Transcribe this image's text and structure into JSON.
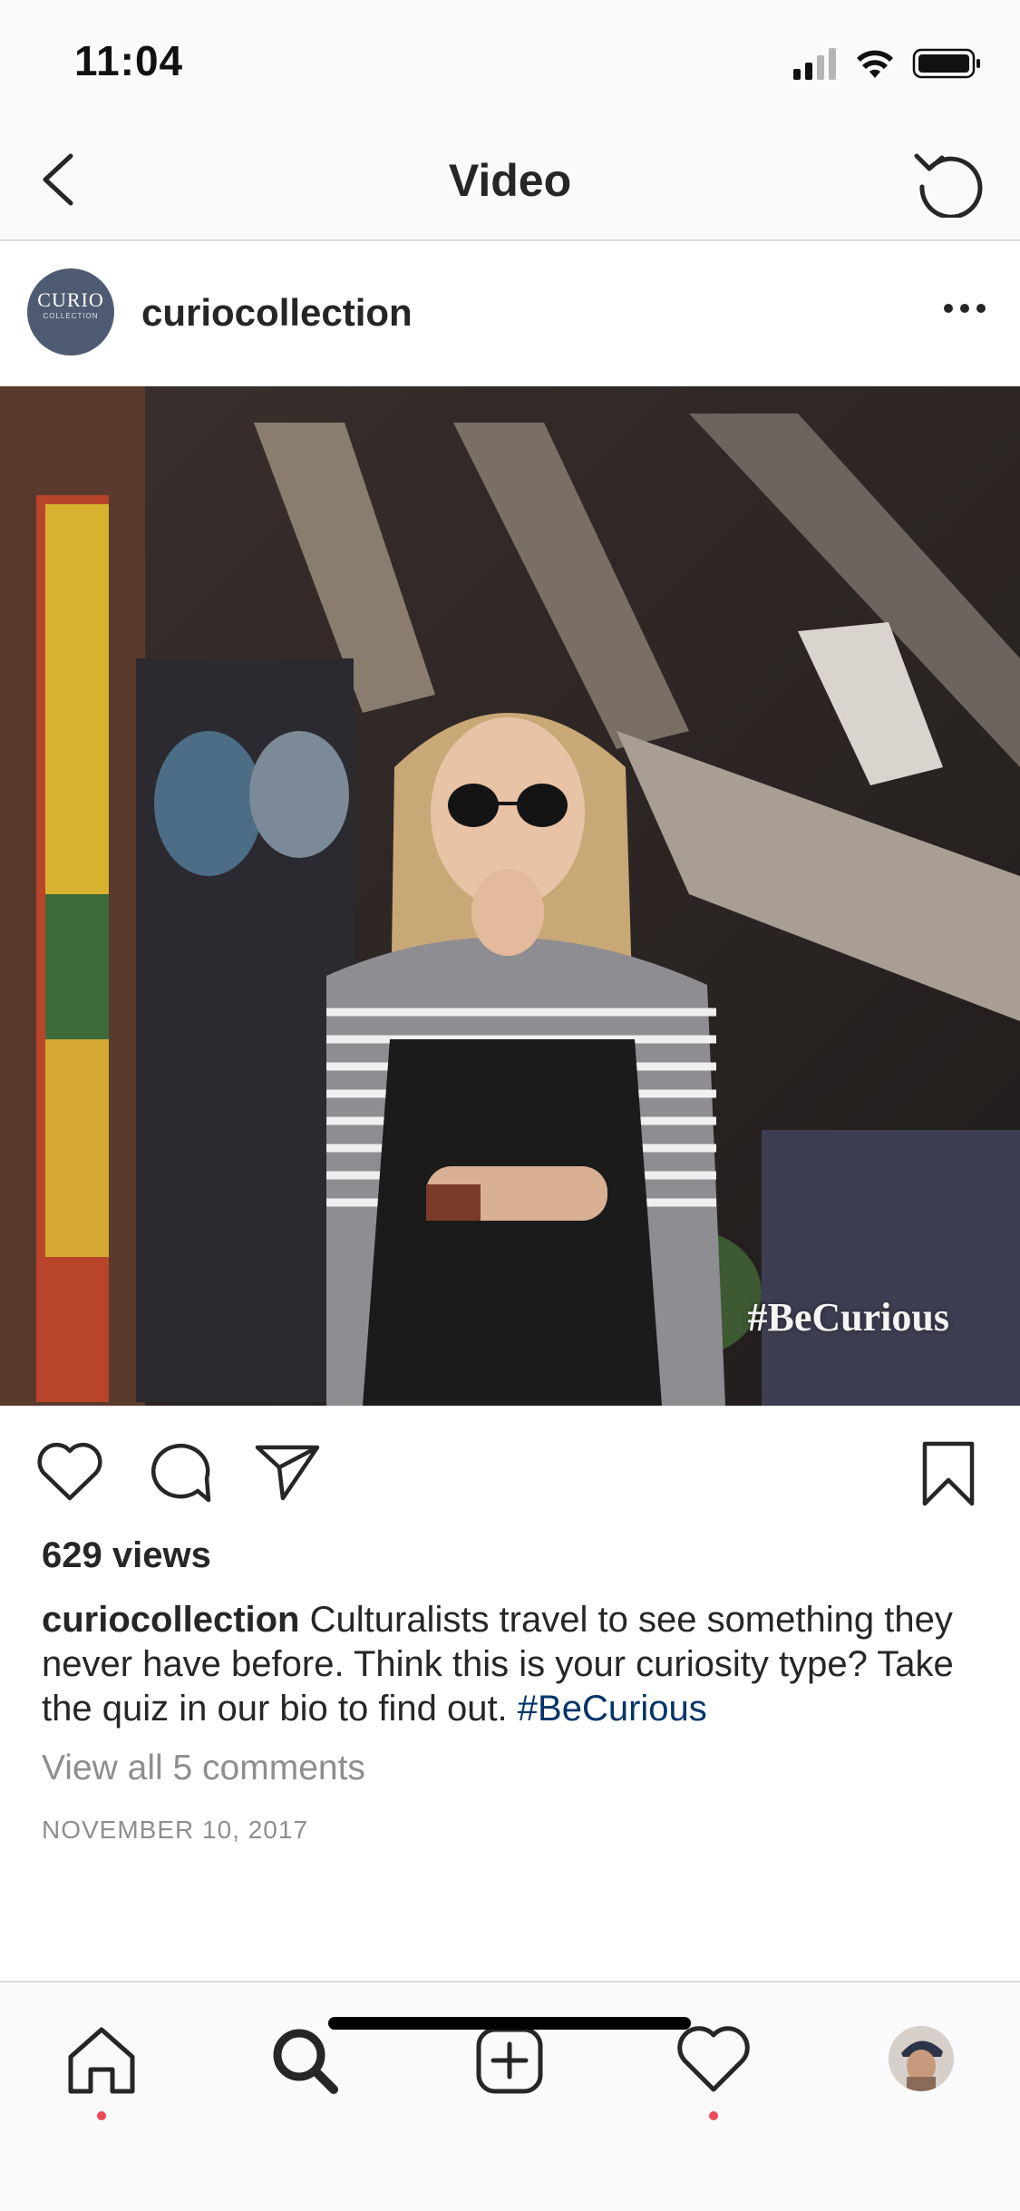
{
  "status_bar": {
    "time": "11:04"
  },
  "nav": {
    "title": "Video"
  },
  "post": {
    "username": "curiocollection",
    "avatar_text": "CURIO",
    "avatar_subtext": "COLLECTION",
    "video_overlay_text": "#BeCurious",
    "views": "629 views",
    "caption_user": "curiocollection",
    "caption_text": " Culturalists travel to see something they never have before. Think this is your curiosity type? Take the quiz in our bio to find out. ",
    "caption_hashtag": "#BeCurious",
    "view_comments": "View all 5 comments",
    "date": "NOVEMBER 10, 2017"
  },
  "icons": {
    "back": "chevron-left-icon",
    "reload": "reload-icon",
    "more": "more-dots-icon",
    "like": "heart-icon",
    "comment": "comment-icon",
    "share": "send-icon",
    "save": "bookmark-icon",
    "home": "home-icon",
    "search": "search-icon",
    "add": "add-post-icon",
    "activity": "heart-icon",
    "profile": "profile-avatar"
  },
  "colors": {
    "hashtag_link": "#003569",
    "notification_dot": "#ed4956",
    "muted_text": "#8e8e8e"
  }
}
